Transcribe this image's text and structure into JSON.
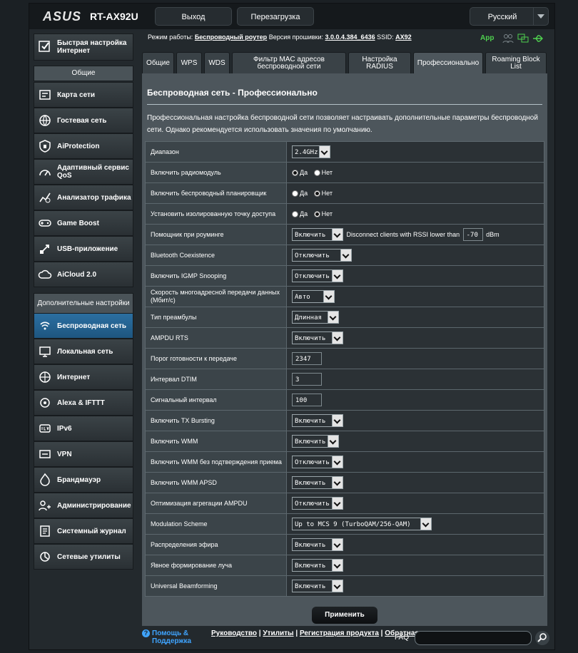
{
  "header": {
    "brand": "ASUS",
    "model": "RT-AX92U",
    "logout_label": "Выход",
    "reboot_label": "Перезагрузка",
    "language": "Русский"
  },
  "status": {
    "mode_label": "Режим работы:",
    "mode_value": "Беспроводный роутер",
    "firmware_label": "Версия прошивки:",
    "firmware_value": "3.0.0.4.384_6436",
    "ssid_label": "SSID:",
    "ssid_value": "AX92",
    "app_label": "App"
  },
  "sidebar": {
    "quick_setup": "Быстрая настройка Интернет",
    "general_header": "Общие",
    "general_items": [
      "Карта сети",
      "Гостевая сеть",
      "AiProtection",
      "Адаптивный сервис QoS",
      "Анализатор трафика",
      "Game Boost",
      "USB-приложение",
      "AiCloud 2.0"
    ],
    "advanced_header": "Дополнительные настройки",
    "advanced_items": [
      "Беспроводная сеть",
      "Локальная сеть",
      "Интернет",
      "Alexa & IFTTT",
      "IPv6",
      "VPN",
      "Брандмауэр",
      "Админист­рирование",
      "Системный журнал",
      "Сетевые утилиты"
    ]
  },
  "tabs": [
    "Общие",
    "WPS",
    "WDS",
    "Фильтр MAC адресов беспроводной сети",
    "Настройка RADIUS",
    "Профессионально",
    "Roaming Block List"
  ],
  "page": {
    "title": "Беспроводная сеть - Профессионально",
    "description": "Профессиональная настройка беспроводной сети позволяет настраивать дополнительные параметры беспроводной сети. Однако рекомендуется использовать значения по умолчанию."
  },
  "radio_labels": {
    "yes": "Да",
    "no": "Нет"
  },
  "settings": {
    "band": {
      "label": "Диапазон",
      "value": "2.4GHz"
    },
    "radio_enable": {
      "label": "Включить радиомодуль",
      "selected": "yes"
    },
    "scheduler": {
      "label": "Включить беспроводный планировщик",
      "selected": "no"
    },
    "isolation": {
      "label": "Установить изолированную точку доступа",
      "selected": "no"
    },
    "roaming": {
      "label": "Помощник при роуминге",
      "value": "Включить",
      "extra": "Disconnect clients with RSSI lower than",
      "rssi": "-70",
      "unit": "dBm"
    },
    "bt_coex": {
      "label": "Bluetooth Coexistence",
      "value": "Отключить"
    },
    "igmp": {
      "label": "Включить IGMP Snooping",
      "value": "Отключить"
    },
    "multicast": {
      "label": "Скорость многоадресной передачи данных (Мбит/с)",
      "value": "Авто"
    },
    "preamble": {
      "label": "Тип преамбулы",
      "value": "Длинная"
    },
    "ampdu_rts": {
      "label": "AMPDU RTS",
      "value": "Включить"
    },
    "rts": {
      "label": "Порог готовности к передаче",
      "value": "2347"
    },
    "dtim": {
      "label": "Интервал DTIM",
      "value": "3"
    },
    "beacon": {
      "label": "Сигнальный интервал",
      "value": "100"
    },
    "tx_burst": {
      "label": "Включить TX Bursting",
      "value": "Включить"
    },
    "wmm": {
      "label": "Включить WMM",
      "value": "Включить"
    },
    "wmm_noack": {
      "label": "Включить WMM без подтверждения приема",
      "value": "Отключить"
    },
    "wmm_apsd": {
      "label": "Включить WMM APSD",
      "value": "Включить"
    },
    "ampdu_opt": {
      "label": "Оптимизация агрегации AMPDU",
      "value": "Отключить"
    },
    "modulation": {
      "label": "Modulation Scheme",
      "value": "Up to MCS 9 (TurboQAM/256-QAM)"
    },
    "airtime": {
      "label": "Распределения эфира",
      "value": "Включить"
    },
    "beamforming": {
      "label": "Явное формирование луча",
      "value": "Включить"
    },
    "universal_bf": {
      "label": "Universal Beamforming",
      "value": "Включить"
    }
  },
  "apply_label": "Применить",
  "footer": {
    "help": "Помощь & Поддержка",
    "manual": "Руководство",
    "utilities": "Утилиты",
    "registration": "Регистрация продукта",
    "feedback": "Обратная связь",
    "faq": "FAQ"
  }
}
